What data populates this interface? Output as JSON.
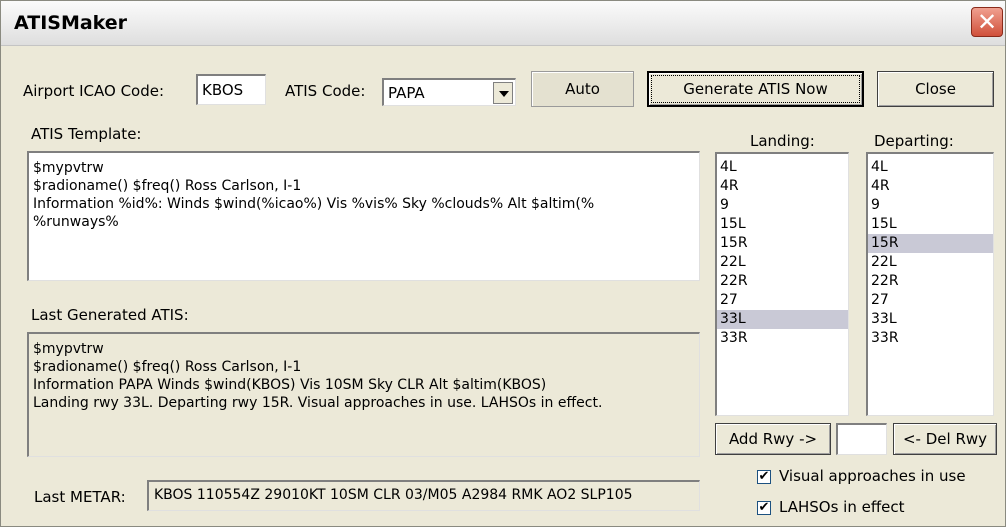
{
  "window": {
    "title": "ATISMaker"
  },
  "header": {
    "icao_label": "Airport ICAO Code:",
    "icao_value": "KBOS",
    "atis_code_label": "ATIS Code:",
    "atis_code_value": "PAPA",
    "auto_label": "Auto",
    "generate_label": "Generate ATIS Now",
    "close_label": "Close"
  },
  "template": {
    "label": "ATIS Template:",
    "lines": [
      "$mypvtrw",
      "$radioname() $freq() Ross Carlson, I-1",
      "Information %id%: Winds $wind(%icao%) Vis %vis% Sky %clouds% Alt $altim(%",
      "%runways%"
    ]
  },
  "generated": {
    "label": "Last Generated ATIS:",
    "lines": [
      "$mypvtrw",
      "$radioname() $freq() Ross Carlson, I-1",
      "Information PAPA Winds $wind(KBOS) Vis 10SM Sky CLR Alt $altim(KBOS)",
      "Landing rwy 33L. Departing rwy 15R. Visual approaches in use. LAHSOs in effect."
    ]
  },
  "metar": {
    "label": "Last METAR:",
    "value": "KBOS 110554Z 29010KT 10SM CLR 03/M05 A2984 RMK AO2 SLP105"
  },
  "landing": {
    "label": "Landing:",
    "items": [
      "4L",
      "4R",
      "9",
      "15L",
      "15R",
      "22L",
      "22R",
      "27",
      "33L",
      "33R"
    ],
    "selected": "33L"
  },
  "departing": {
    "label": "Departing:",
    "items": [
      "4L",
      "4R",
      "9",
      "15L",
      "15R",
      "22L",
      "22R",
      "27",
      "33L",
      "33R"
    ],
    "selected": "15R"
  },
  "runway_controls": {
    "add_label": "Add Rwy ->",
    "new_rwy_value": "",
    "del_label": "<- Del Rwy"
  },
  "options": {
    "visual_label": "Visual approaches in use",
    "visual_checked": true,
    "lahso_label": "LAHSOs in effect",
    "lahso_checked": true
  }
}
